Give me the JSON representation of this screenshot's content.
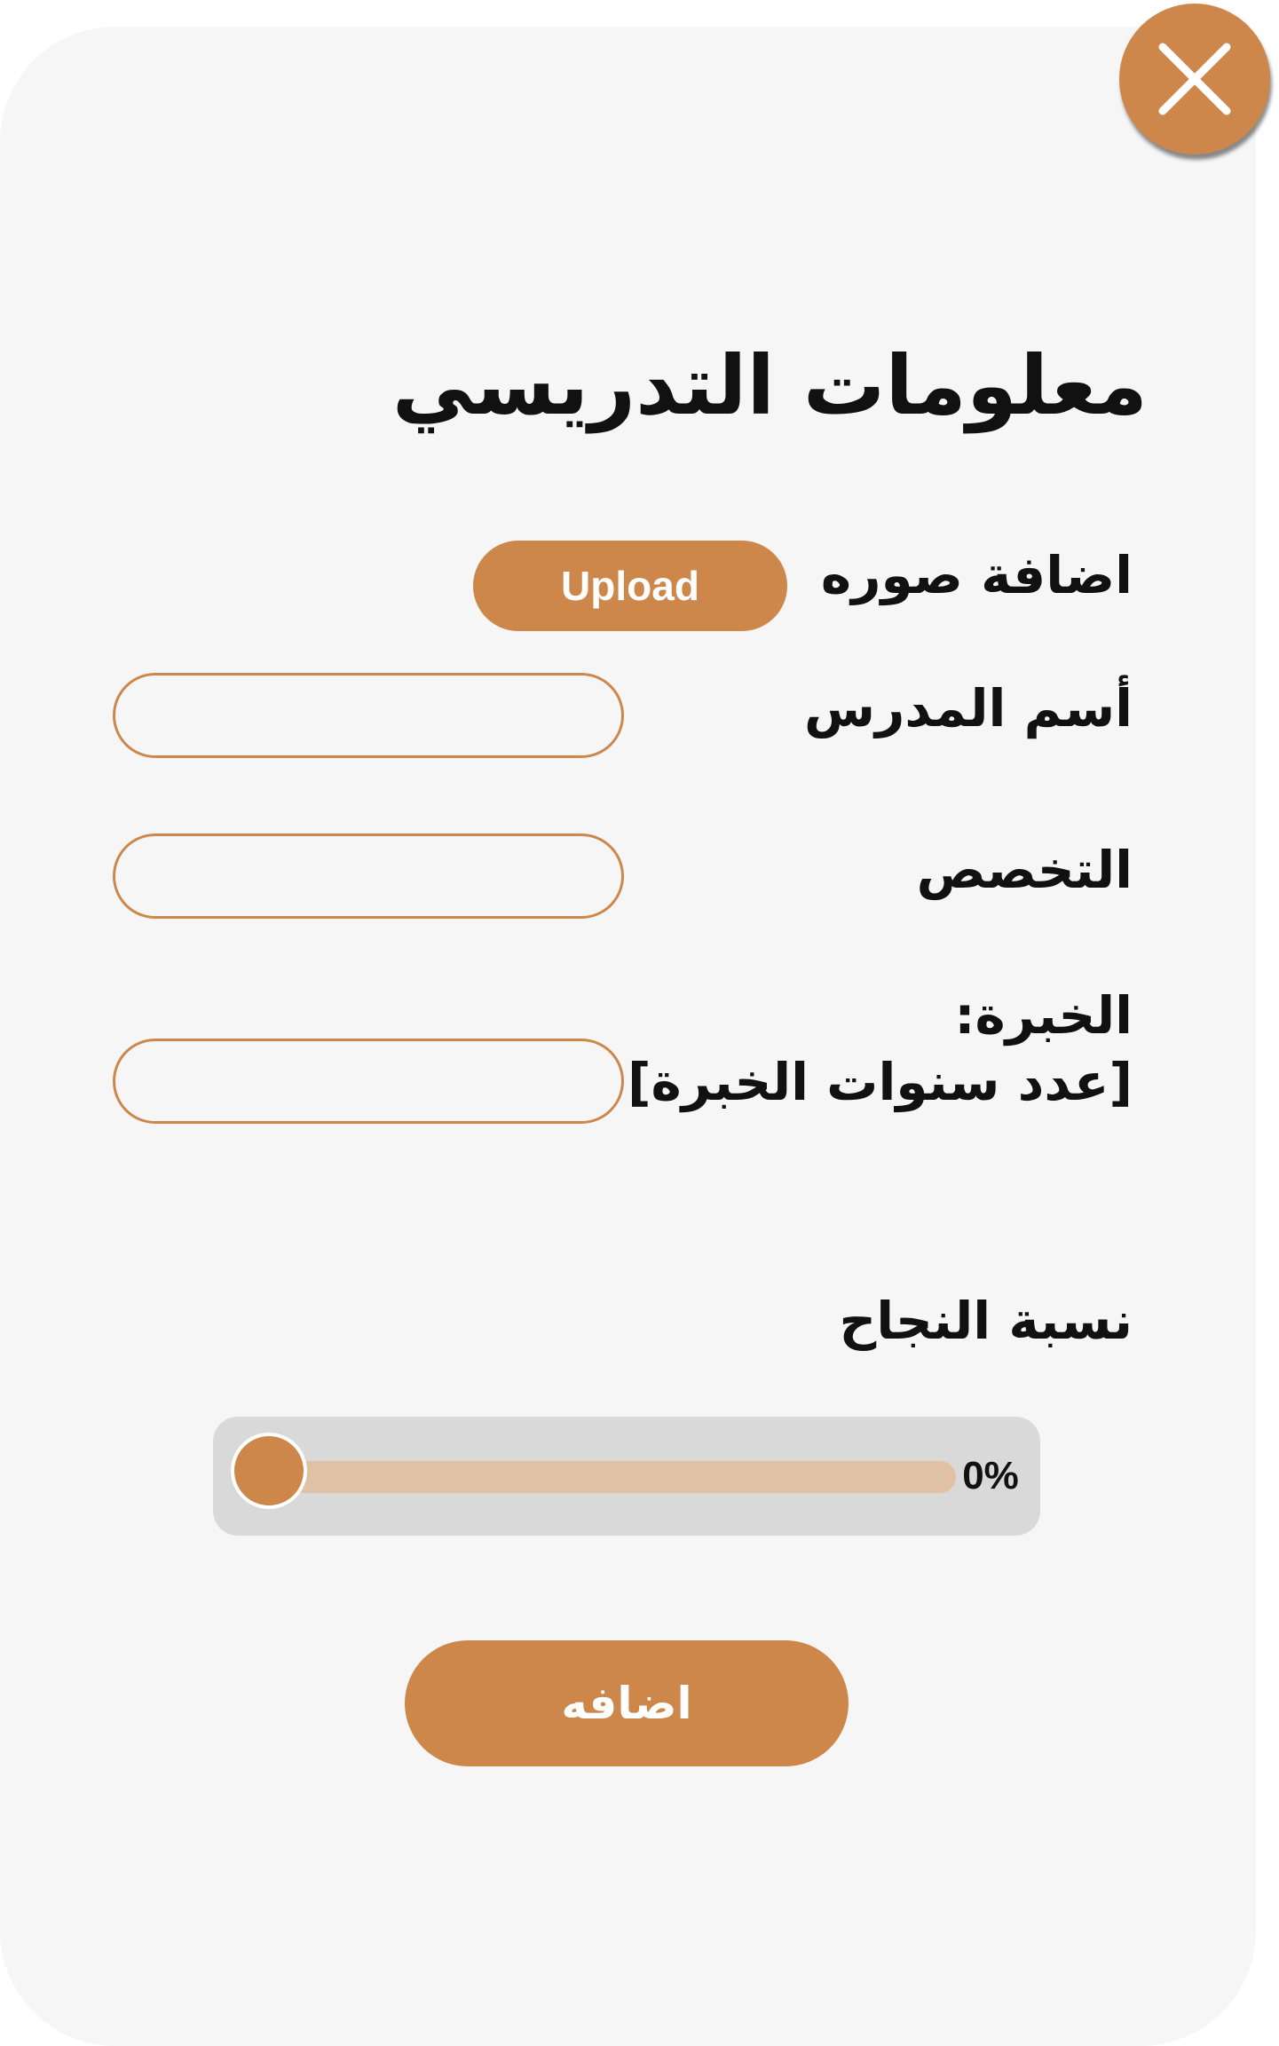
{
  "dialog": {
    "title": "معلومات التدريسي",
    "close_icon": "close-icon"
  },
  "form": {
    "image": {
      "label": "اضافة صوره",
      "button_label": "Upload"
    },
    "teacher_name": {
      "label": "أسم المدرس",
      "value": ""
    },
    "specialization": {
      "label": "التخصص",
      "value": ""
    },
    "experience": {
      "label_line1": "الخبرة:",
      "label_line2": "[عدد سنوات الخبرة]",
      "value": ""
    },
    "success_rate": {
      "label": "نسبة النجاح",
      "value": 0,
      "value_text": "0%"
    },
    "submit_label": "اضافه"
  },
  "colors": {
    "accent": "#cd874a",
    "card_background": "#f6f6f6",
    "slider_track": "#dfc1a5",
    "slider_container": "#d9d9d9"
  }
}
